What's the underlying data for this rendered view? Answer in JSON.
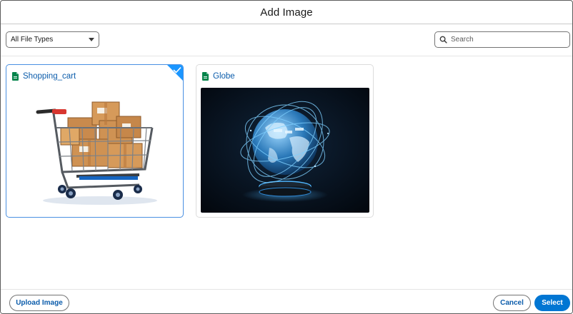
{
  "modal": {
    "title": "Add Image"
  },
  "toolbar": {
    "file_type_selected": "All File Types",
    "search_placeholder": "Search"
  },
  "files": [
    {
      "name": "Shopping_cart",
      "selected": true,
      "icon": "image-file-icon",
      "thumbnail": "shopping-cart-with-boxes"
    },
    {
      "name": "Globe",
      "selected": false,
      "icon": "image-file-icon",
      "thumbnail": "glowing-digital-globe"
    }
  ],
  "footer": {
    "upload_label": "Upload Image",
    "cancel_label": "Cancel",
    "select_label": "Select"
  },
  "colors": {
    "brand": "#0176d3",
    "link": "#0b5cab",
    "selected_border": "#4a90e2",
    "file_icon": "#04844b"
  }
}
